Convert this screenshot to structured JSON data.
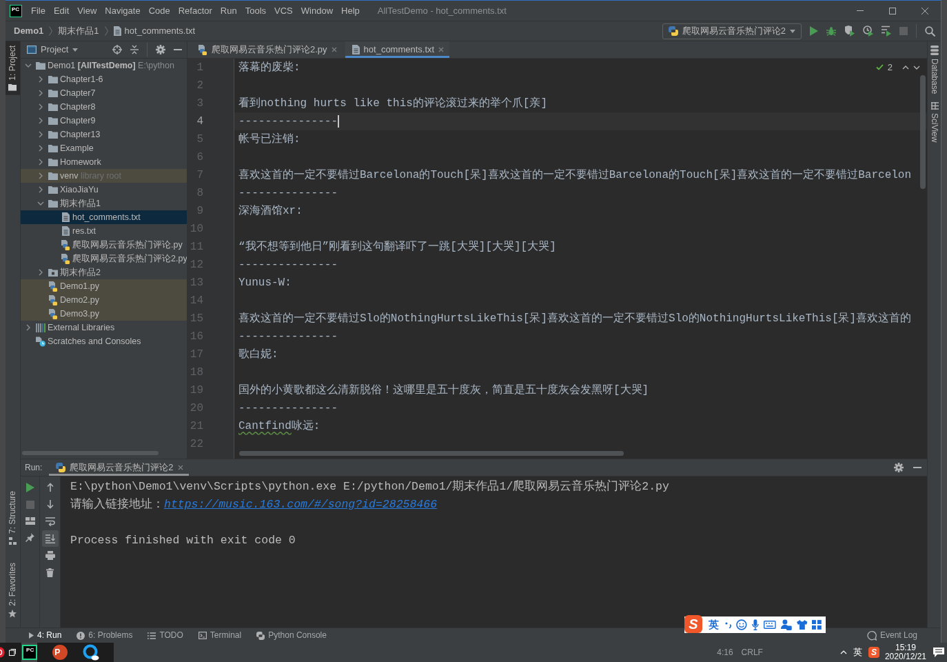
{
  "window": {
    "logo": "PC",
    "title": "AllTestDemo - hot_comments.txt"
  },
  "menu": [
    "File",
    "Edit",
    "View",
    "Navigate",
    "Code",
    "Refactor",
    "Run",
    "Tools",
    "VCS",
    "Window",
    "Help"
  ],
  "breadcrumbs": [
    {
      "label": "Demo1",
      "kind": "project"
    },
    {
      "label": "期末作品1",
      "kind": "folder"
    },
    {
      "label": "hot_comments.txt",
      "kind": "text"
    }
  ],
  "run_toolbar": {
    "configuration": "爬取网易云音乐热门评论2",
    "stop_disabled": true
  },
  "side_tabs": {
    "left_top": [
      {
        "label": "1: Project",
        "kind": "project",
        "selected": true
      }
    ],
    "left_bottom": [
      {
        "label": "7: Structure",
        "kind": "structure",
        "selected": false
      },
      {
        "label": "2: Favorites",
        "kind": "favorites",
        "selected": false
      }
    ],
    "right": [
      {
        "label": "Database",
        "kind": "database",
        "selected": false
      },
      {
        "label": "SciView",
        "kind": "sciview",
        "selected": false
      }
    ]
  },
  "project_panel": {
    "view": "Project",
    "tree": [
      {
        "label": "Demo1",
        "tag": "[AllTestDemo]",
        "path": "E:\\python",
        "kind": "project",
        "expanded": true,
        "selected": false,
        "tinted": false,
        "children": [
          {
            "label": "Chapter1-6",
            "kind": "folder",
            "expanded": false,
            "selected": false,
            "tinted": false
          },
          {
            "label": "Chapter7",
            "kind": "folder",
            "expanded": false,
            "selected": false,
            "tinted": false
          },
          {
            "label": "Chapter8",
            "kind": "folder",
            "expanded": false,
            "selected": false,
            "tinted": false
          },
          {
            "label": "Chapter9",
            "kind": "folder",
            "expanded": false,
            "selected": false,
            "tinted": false
          },
          {
            "label": "Chapter13",
            "kind": "folder",
            "expanded": false,
            "selected": false,
            "tinted": false
          },
          {
            "label": "Example",
            "kind": "folder",
            "expanded": false,
            "selected": false,
            "tinted": false
          },
          {
            "label": "Homework",
            "kind": "folder",
            "expanded": false,
            "selected": false,
            "tinted": false
          },
          {
            "label": "venv",
            "hint": "library root",
            "kind": "folder",
            "expanded": false,
            "selected": false,
            "tinted": true
          },
          {
            "label": "XiaoJiaYu",
            "kind": "folder",
            "expanded": false,
            "selected": false,
            "tinted": false
          },
          {
            "label": "期末作品1",
            "kind": "folder",
            "expanded": true,
            "selected": false,
            "tinted": false,
            "children": [
              {
                "label": "hot_comments.txt",
                "kind": "text",
                "selected": true,
                "tinted": false
              },
              {
                "label": "res.txt",
                "kind": "text",
                "selected": false,
                "tinted": false
              },
              {
                "label": "爬取网易云音乐热门评论.py",
                "kind": "python",
                "selected": false,
                "tinted": false
              },
              {
                "label": "爬取网易云音乐热门评论2.py",
                "kind": "python",
                "selected": false,
                "tinted": false
              }
            ]
          },
          {
            "label": "期末作品2",
            "kind": "package",
            "expanded": false,
            "selected": false,
            "tinted": false
          },
          {
            "label": "Demo1.py",
            "kind": "python",
            "selected": false,
            "tinted": true
          },
          {
            "label": "Demo2.py",
            "kind": "python",
            "selected": false,
            "tinted": true
          },
          {
            "label": "Demo3.py",
            "kind": "python",
            "selected": false,
            "tinted": true
          }
        ]
      },
      {
        "label": "External Libraries",
        "kind": "libraries",
        "expanded": false,
        "selected": false,
        "tinted": false
      },
      {
        "label": "Scratches and Consoles",
        "kind": "scratches",
        "selected": false,
        "tinted": false
      }
    ]
  },
  "editor": {
    "tabs": [
      {
        "label": "爬取网易云音乐热门评论2.py",
        "kind": "python",
        "selected": false
      },
      {
        "label": "hot_comments.txt",
        "kind": "text",
        "selected": true
      }
    ],
    "inspection": {
      "count": "2"
    },
    "lines": [
      {
        "number": "1",
        "text": "落幕的废柴:",
        "current": false
      },
      {
        "number": "2",
        "current": false
      },
      {
        "number": "3",
        "text": "看到nothing hurts like this的评论滚过来的举个爪[亲]",
        "current": false
      },
      {
        "number": "4",
        "text": "---------------",
        "current": true
      },
      {
        "number": "5",
        "text": "帐号已注销:",
        "current": false
      },
      {
        "number": "6",
        "current": false
      },
      {
        "number": "7",
        "text": "喜欢这首的一定不要错过Barcelona的Touch[呆]喜欢这首的一定不要错过Barcelona的Touch[呆]喜欢这首的一定不要错过Barcelon",
        "current": false
      },
      {
        "number": "8",
        "text": "---------------",
        "current": false
      },
      {
        "number": "9",
        "text": "深海酒馆xr:",
        "current": false
      },
      {
        "number": "10",
        "current": false
      },
      {
        "number": "11",
        "text": "“我不想等到他日”刚看到这句翻译吓了一跳[大哭][大哭][大哭]",
        "current": false
      },
      {
        "number": "12",
        "text": "---------------",
        "current": false
      },
      {
        "number": "13",
        "text": "Yunus-W:",
        "current": false
      },
      {
        "number": "14",
        "current": false
      },
      {
        "number": "15",
        "text": "喜欢这首的一定不要错过Slo的NothingHurtsLikeThis[呆]喜欢这首的一定不要错过Slo的NothingHurtsLikeThis[呆]喜欢这首的",
        "current": false
      },
      {
        "number": "16",
        "text": "---------------",
        "current": false
      },
      {
        "number": "17",
        "text": "歌白妮:",
        "current": false
      },
      {
        "number": "18",
        "current": false
      },
      {
        "number": "19",
        "text": "国外的小黄歌都这么清新脱俗！这哪里是五十度灰，简直是五十度灰会发黑呀[大哭]",
        "current": false
      },
      {
        "number": "20",
        "text": "---------------",
        "current": false
      },
      {
        "number": "21",
        "parts": [
          {
            "text": "Cantfind",
            "typo": true
          },
          {
            "text": "咏远:",
            "typo": false
          }
        ],
        "current": false
      },
      {
        "number": "22",
        "current": false
      }
    ]
  },
  "run_panel": {
    "title": "Run:",
    "tab": "爬取网易云音乐热门评论2",
    "stop_disabled": true,
    "scroll_to_end": true,
    "console": [
      {
        "kind": "command",
        "text": "E:\\python\\Demo1\\venv\\Scripts\\python.exe E:/python/Demo1/期末作品1/爬取网易云音乐热门评论2.py"
      },
      {
        "kind": "prompt",
        "text": "请输入链接地址：",
        "input": "https://music.163.com/#/song?id=28258466"
      },
      {
        "kind": "blank"
      },
      {
        "kind": "output",
        "text": "Process finished with exit code 0"
      }
    ]
  },
  "tool_windows": [
    {
      "label": "4: Run",
      "kind": "run",
      "selected": true
    },
    {
      "label": "6: Problems",
      "kind": "problems",
      "selected": false
    },
    {
      "label": "TODO",
      "kind": "todo",
      "selected": false
    },
    {
      "label": "Terminal",
      "kind": "terminal",
      "selected": false
    },
    {
      "label": "Python Console",
      "kind": "console",
      "selected": false
    }
  ],
  "event_log": "Event Log",
  "status_bar": {
    "caret_position": "4:16",
    "line_separator": "CRLF"
  },
  "ime_toolbar": {
    "logo": "S",
    "mode": "英"
  },
  "taskbar": {
    "apps": [
      {
        "kind": "ide",
        "label": "PC",
        "selected": true
      },
      {
        "kind": "slides",
        "label": "P",
        "selected": false
      },
      {
        "kind": "browser",
        "selected": false
      }
    ],
    "tray": {
      "ime_mode": "英",
      "ime_logo": "S"
    },
    "time": "15:19",
    "date": "2020/12/21"
  }
}
